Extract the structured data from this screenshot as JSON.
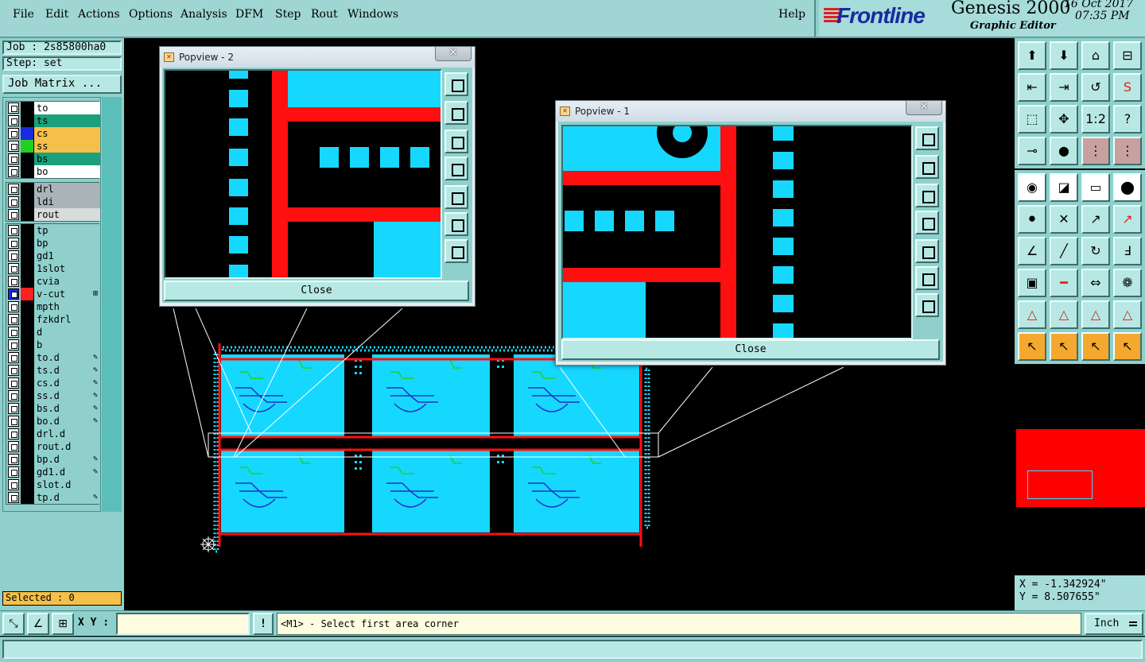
{
  "menu": {
    "items": [
      "File",
      "Edit",
      "Actions",
      "Options",
      "Analysis",
      "DFM",
      "Step",
      "Rout",
      "Windows"
    ],
    "help": "Help"
  },
  "brand": {
    "logo": "Frontline",
    "product": "Genesis 2000",
    "subtitle": "Graphic Editor",
    "date": "16 Oct 2017",
    "time": "07:35 PM"
  },
  "job": {
    "job_label": "Job : 2s85800ha0",
    "step_label": "Step: set",
    "matrix_button": "Job Matrix ..."
  },
  "layers": {
    "group1": [
      {
        "name": "to",
        "bg": "#ffffff",
        "color": "#000000"
      },
      {
        "name": "ts",
        "bg": "#1aa07a",
        "color": "#000000"
      },
      {
        "name": "cs",
        "bg": "#f5c04a",
        "color": "#1a2ae0"
      },
      {
        "name": "ss",
        "bg": "#f5c04a",
        "color": "#22d022"
      },
      {
        "name": "bs",
        "bg": "#1aa07a",
        "color": "#000000"
      },
      {
        "name": "bo",
        "bg": "#ffffff",
        "color": "#000000"
      }
    ],
    "group2": [
      {
        "name": "drl",
        "bg": "#a8b4b8",
        "color": "#000000"
      },
      {
        "name": "ldi",
        "bg": "#a8b4b8",
        "color": "#000000"
      },
      {
        "name": "rout",
        "bg": "#d8dcdc",
        "color": "#000000"
      }
    ],
    "group3": [
      {
        "name": "tp",
        "mark": ""
      },
      {
        "name": "bp",
        "mark": ""
      },
      {
        "name": "gd1",
        "mark": ""
      },
      {
        "name": "1slot",
        "mark": ""
      },
      {
        "name": "cvia",
        "mark": ""
      },
      {
        "name": "v-cut",
        "mark": "⊞",
        "color": "#ff2020",
        "cbcolor": "#1a2ae0"
      },
      {
        "name": "mpth",
        "mark": ""
      },
      {
        "name": "fzkdrl",
        "mark": ""
      },
      {
        "name": "d",
        "mark": ""
      },
      {
        "name": "b",
        "mark": ""
      },
      {
        "name": "to.d",
        "mark": "✎"
      },
      {
        "name": "ts.d",
        "mark": "✎"
      },
      {
        "name": "cs.d",
        "mark": "✎"
      },
      {
        "name": "ss.d",
        "mark": "✎"
      },
      {
        "name": "bs.d",
        "mark": "✎"
      },
      {
        "name": "bo.d",
        "mark": "✎"
      },
      {
        "name": "drl.d",
        "mark": ""
      },
      {
        "name": "rout.d",
        "mark": ""
      },
      {
        "name": "bp.d",
        "mark": "✎"
      },
      {
        "name": "gd1.d",
        "mark": "✎"
      },
      {
        "name": "slot.d",
        "mark": ""
      },
      {
        "name": "tp.d",
        "mark": "✎"
      }
    ]
  },
  "selected": "Selected : 0",
  "popview2": {
    "title": "Popview - 2",
    "close_x": "✕",
    "close_button": "Close"
  },
  "popview1": {
    "title": "Popview - 1",
    "close_x": "✕",
    "close_button": "Close"
  },
  "coords": {
    "x": "X = -1.342924\"",
    "y": "Y = 8.507655\""
  },
  "bottom": {
    "xy_label": "X Y :",
    "xy_value": "",
    "bang": "!",
    "prompt": "<M1> - Select first area corner",
    "unit": "Inch"
  },
  "colors": {
    "copper": "#16d8ff",
    "vcut": "#ff1010",
    "panel": "#8fd0cc"
  },
  "tools_top": [
    "page-up-icon",
    "page-down-icon",
    "home-icon",
    "window-split-icon",
    "zoom-left-icon",
    "zoom-right-icon",
    "undo-icon",
    "redraw-icon",
    "fit-all-icon",
    "zoom-center-icon",
    "one-to-two-icon",
    "help-icon",
    "measure-bar-icon",
    "snap-icon",
    "layer-toggle-a-icon",
    "layer-toggle-b-icon"
  ],
  "tools_main": [
    "add-pad-icon",
    "add-surface-icon",
    "ruler-icon",
    "drill-pad-icon",
    "connect-icon",
    "cross-icon",
    "move-arrow-icon",
    "move-arrow-red-icon",
    "line-angle-icon",
    "line-diagonal-icon",
    "arc-icon",
    "text-flip-icon",
    "pad-select-icon",
    "line-red-icon",
    "dimension-icon",
    "blob-icon",
    "triangle-a-icon",
    "triangle-b-icon",
    "triangle-c-icon",
    "triangle-d-icon",
    "pointer-icon",
    "pointer-box-icon",
    "pointer-diamond-icon",
    "pointer-net-icon"
  ],
  "tool_one_two": "1:2",
  "tool_help": "?"
}
